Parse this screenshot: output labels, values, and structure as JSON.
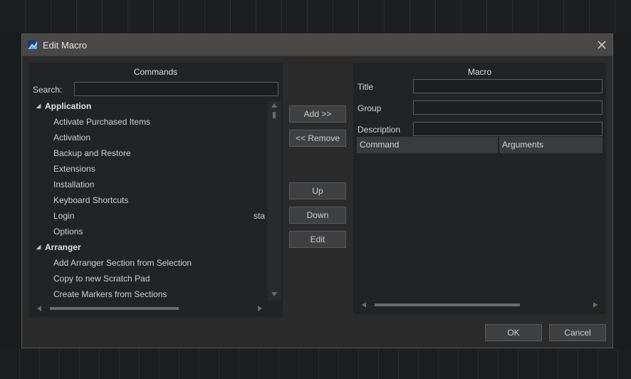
{
  "window": {
    "title": "Edit Macro"
  },
  "commands_panel": {
    "header": "Commands",
    "search_label": "Search:",
    "search_value": "",
    "tree": [
      {
        "label": "Application",
        "group": true
      },
      {
        "label": "Activate Purchased Items"
      },
      {
        "label": "Activation"
      },
      {
        "label": "Backup and Restore"
      },
      {
        "label": "Extensions"
      },
      {
        "label": "Installation"
      },
      {
        "label": "Keyboard Shortcuts"
      },
      {
        "label": "Login",
        "extra": "sta"
      },
      {
        "label": "Options"
      },
      {
        "label": "Arranger",
        "group": true
      },
      {
        "label": "Add Arranger Section from Selection"
      },
      {
        "label": "Copy to new Scratch Pad"
      },
      {
        "label": "Create Markers from Sections"
      }
    ]
  },
  "middle_buttons": {
    "add": "Add >>",
    "remove": "<< Remove",
    "up": "Up",
    "down": "Down",
    "edit": "Edit"
  },
  "macro_panel": {
    "header": "Macro",
    "title_label": "Title",
    "title_value": "",
    "group_label": "Group",
    "group_value": "",
    "description_label": "Description",
    "description_value": "",
    "columns": [
      "Command",
      "Arguments"
    ]
  },
  "footer": {
    "ok": "OK",
    "cancel": "Cancel"
  },
  "icons": {
    "app": "studio-one-icon",
    "close": "close-icon",
    "expand": "triangle-down-icon"
  },
  "colors": {
    "titlebar": "#4a4846",
    "dialog": "#2b2b2b",
    "panel": "#222325",
    "button": "#3f4042"
  }
}
